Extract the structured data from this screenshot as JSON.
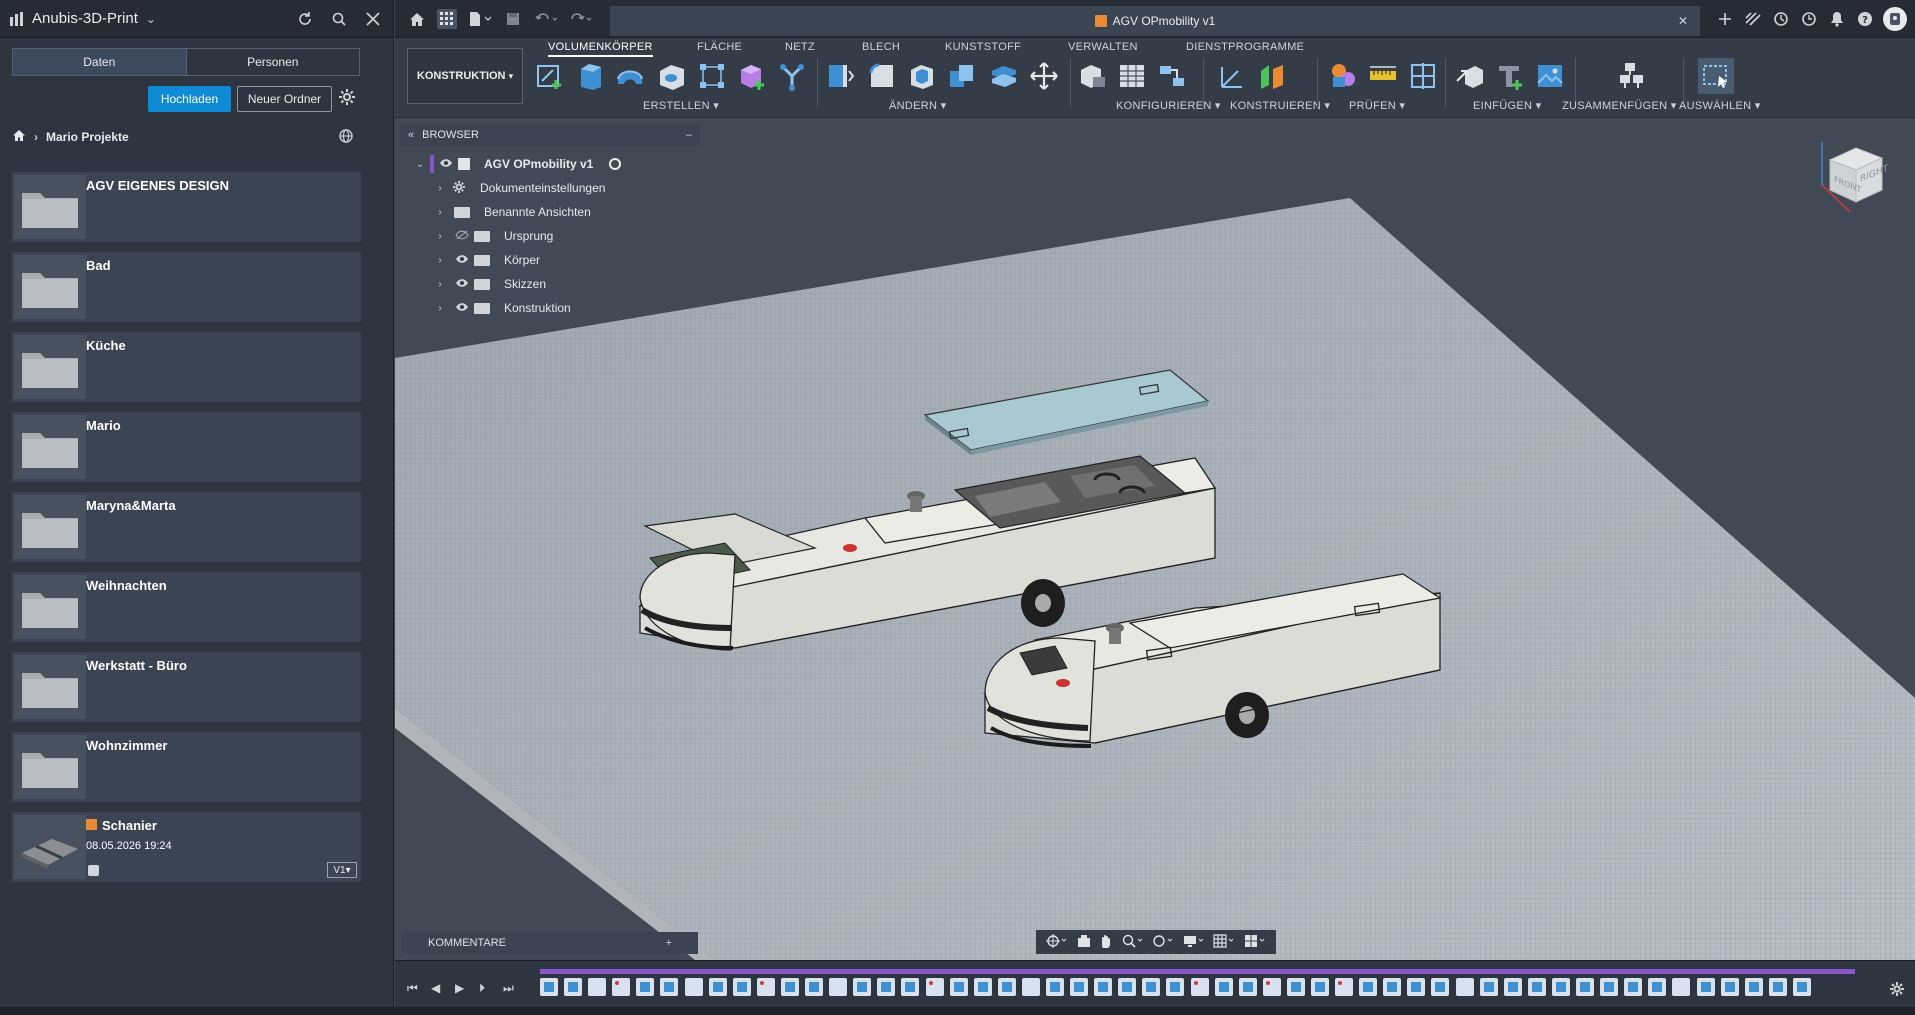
{
  "data_panel": {
    "project_name": "Anubis-3D-Print",
    "tabs": [
      "Daten",
      "Personen"
    ],
    "upload_label": "Hochladen",
    "new_folder_label": "Neuer Ordner",
    "breadcrumb": "Mario Projekte",
    "items": [
      {
        "name": "AGV EIGENES DESIGN",
        "type": "folder"
      },
      {
        "name": "Bad",
        "type": "folder"
      },
      {
        "name": "Küche",
        "type": "folder"
      },
      {
        "name": "Mario",
        "type": "folder"
      },
      {
        "name": "Maryna&Marta",
        "type": "folder"
      },
      {
        "name": "Weihnachten",
        "type": "folder"
      },
      {
        "name": "Werkstatt - Büro",
        "type": "folder"
      },
      {
        "name": "Wohnzimmer",
        "type": "folder"
      },
      {
        "name": "Schanier",
        "type": "design",
        "date": "08.05.2026 19:24",
        "version": "V1"
      }
    ]
  },
  "document": {
    "title": "AGV OPmobility v1"
  },
  "ribbon": {
    "workspace": "KONSTRUKTION",
    "tabs": [
      "VOLUMENKÖRPER",
      "FLÄCHE",
      "NETZ",
      "BLECH",
      "KUNSTSTOFF",
      "VERWALTEN",
      "DIENSTPROGRAMME"
    ],
    "active_tab": "VOLUMENKÖRPER",
    "groups": [
      "ERSTELLEN",
      "ÄNDERN",
      "KONFIGURIEREN",
      "KONSTRUIEREN",
      "PRÜFEN",
      "EINFÜGEN",
      "ZUSAMMENFÜGEN",
      "AUSWÄHLEN"
    ]
  },
  "browser": {
    "header": "BROWSER",
    "root": "AGV OPmobility v1",
    "nodes": [
      "Dokumenteinstellungen",
      "Benannte Ansichten",
      "Ursprung",
      "Körper",
      "Skizzen",
      "Konstruktion"
    ]
  },
  "viewcube": {
    "face_right": "RIGHT",
    "face_front": "FRONT"
  },
  "comments": {
    "label": "KOMMENTARE"
  },
  "colors": {
    "accent": "#0f8ad4",
    "timeline": "#8a55c9",
    "panel_bg": "#2d3540",
    "canvas_bg": "#414955"
  }
}
